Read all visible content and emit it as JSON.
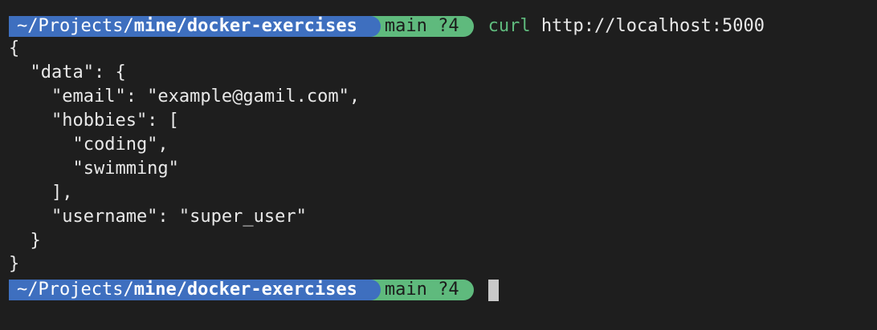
{
  "prompt": {
    "path_prefix": "~/Projects/",
    "path_bold": "mine/docker-exercises",
    "git_status": "main ?4"
  },
  "command": {
    "name": "curl",
    "argument": "http://localhost:5000"
  },
  "output_lines": [
    "{",
    "  \"data\": {",
    "    \"email\": \"example@gamil.com\",",
    "    \"hobbies\": [",
    "      \"coding\",",
    "      \"swimming\"",
    "    ],",
    "    \"username\": \"super_user\"",
    "  }",
    "}"
  ],
  "colors": {
    "background": "#1e1e1e",
    "path_segment": "#3e6fbf",
    "git_segment": "#5fba7d",
    "command_name": "#5fba7d",
    "text": "#e8e8e8"
  }
}
